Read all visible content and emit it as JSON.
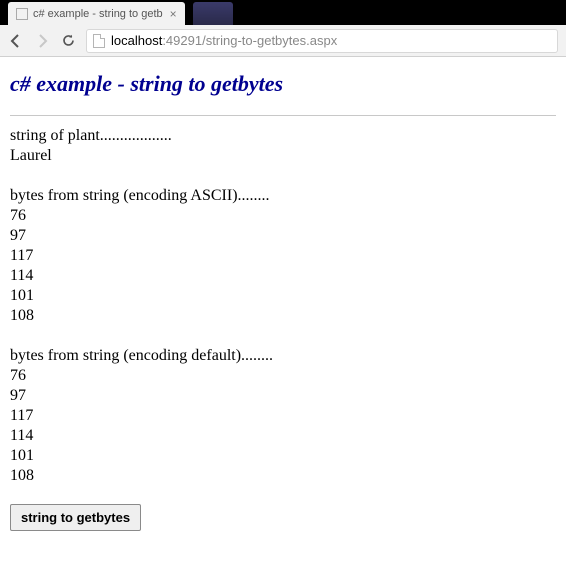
{
  "browser": {
    "tab_title": "c# example - string to getb",
    "tab_close": "×",
    "url_host": "localhost",
    "url_port": ":49291",
    "url_path": "/string-to-getbytes.aspx"
  },
  "page": {
    "heading": "c# example - string to getbytes",
    "string_label": "string of plant..................",
    "string_value": "Laurel",
    "ascii_label": "bytes from string (encoding ASCII)........",
    "default_label": "bytes from string (encoding default)........",
    "bytes_ascii": [
      "76",
      "97",
      "117",
      "114",
      "101",
      "108"
    ],
    "bytes_default": [
      "76",
      "97",
      "117",
      "114",
      "101",
      "108"
    ],
    "button_label": "string to getbytes"
  }
}
